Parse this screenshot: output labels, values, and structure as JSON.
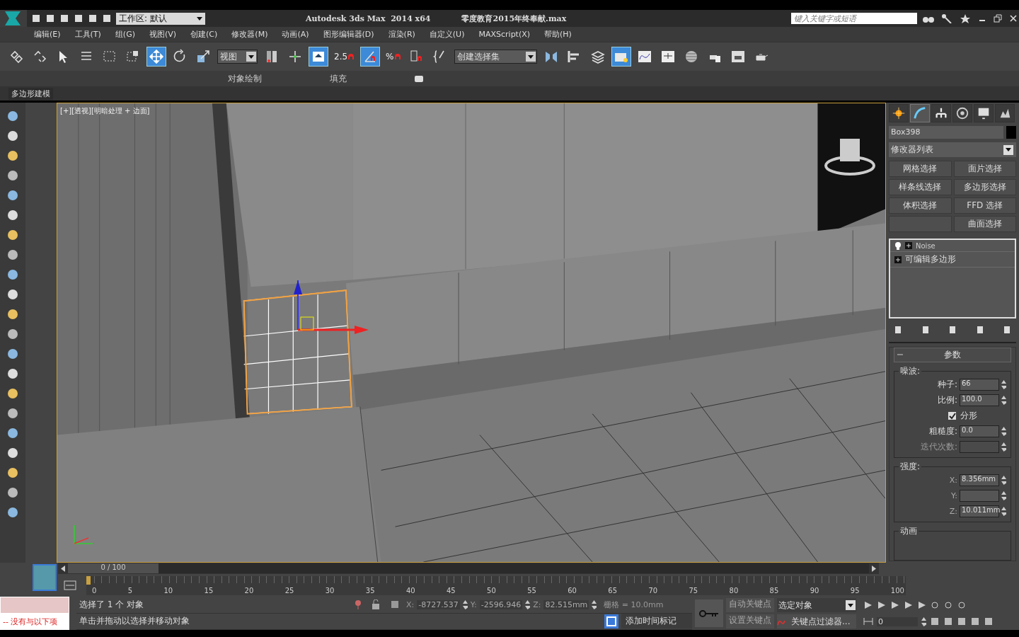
{
  "title_bar": {
    "workspace": "工作区: 默认",
    "app": "Autodesk 3ds Max  2014 x64",
    "file": "零度教育2015年终奉献.max",
    "search": {
      "placeholder": "键入关键字或短语"
    }
  },
  "menu": [
    "编辑(E)",
    "工具(T)",
    "组(G)",
    "视图(V)",
    "创建(C)",
    "修改器(M)",
    "动画(A)",
    "图形编辑器(D)",
    "渲染(R)",
    "自定义(U)",
    "MAXScript(X)",
    "帮助(H)"
  ],
  "main_toolbar": [
    {
      "kind": "icon",
      "active": false
    },
    {
      "kind": "icon",
      "active": false
    },
    {
      "kind": "icon",
      "active": false
    },
    {
      "kind": "icon",
      "active": false
    },
    {
      "kind": "icon",
      "active": false
    },
    {
      "kind": "icon",
      "active": false
    },
    {
      "kind": "icon",
      "active": true
    },
    {
      "kind": "icon",
      "active": false
    },
    {
      "kind": "icon",
      "active": false
    },
    {
      "kind": "dropdown",
      "value": "视图"
    },
    {
      "kind": "icon",
      "active": false
    },
    {
      "kind": "icon",
      "active": false
    },
    {
      "kind": "icon",
      "active": true
    },
    {
      "kind": "snap",
      "label": "2.5",
      "active": false
    },
    {
      "kind": "icon",
      "active": true
    },
    {
      "kind": "snap",
      "label": "%",
      "active": false
    },
    {
      "kind": "icon",
      "active": false
    },
    {
      "kind": "icon",
      "active": false
    },
    {
      "kind": "dropdown",
      "value": "创建选择集"
    },
    {
      "kind": "icon",
      "active": false
    },
    {
      "kind": "icon",
      "active": false
    },
    {
      "kind": "icon",
      "active": false
    },
    {
      "kind": "icon",
      "active": true
    },
    {
      "kind": "icon",
      "active": false
    },
    {
      "kind": "icon",
      "active": false
    },
    {
      "kind": "icon",
      "active": false
    },
    {
      "kind": "icon",
      "active": false
    },
    {
      "kind": "icon",
      "active": false
    },
    {
      "kind": "icon",
      "active": false
    }
  ],
  "ribbon": {
    "tabs": [
      "对象绘制",
      "填充"
    ],
    "panel_label": "多边形建模"
  },
  "viewport": {
    "label": "[+][透视][明暗处理 + 边面]"
  },
  "command_panel": {
    "tabs": [
      {
        "selected": false
      },
      {
        "selected": true
      },
      {
        "selected": false
      },
      {
        "selected": false
      },
      {
        "selected": false
      },
      {
        "selected": false
      }
    ],
    "object_name": "Box398",
    "modifier_list": "修改器列表",
    "modifier_buttons": [
      "网格选择",
      "面片选择",
      "样条线选择",
      "多边形选择",
      "体积选择",
      "FFD 选择",
      "曲面选择"
    ],
    "stack": [
      {
        "label": "Noise",
        "kind": "modifier",
        "expanded": false
      },
      {
        "label": "可编辑多边形",
        "kind": "base",
        "expanded": false
      }
    ],
    "rollout": {
      "title": "参数",
      "noise_group": {
        "title": "噪波:",
        "seed": {
          "label": "种子:",
          "value": "66"
        },
        "scale": {
          "label": "比例:",
          "value": "100.0"
        },
        "fractal": {
          "label": "分形",
          "checked": true
        },
        "roughness": {
          "label": "粗糙度:",
          "value": "0.0"
        },
        "iterations": {
          "label": "迭代次数:",
          "disabled": true
        }
      },
      "strength_group": {
        "title": "强度:",
        "fields": [
          {
            "label": "X:",
            "value": "8.356mm"
          },
          {
            "label": "Y:"
          },
          {
            "label": "Z:",
            "value": "10.011mm"
          }
        ]
      },
      "animation_group": {
        "title": "动画"
      }
    }
  },
  "timeline": {
    "slider": "0 / 100",
    "level": 0,
    "ticks": [
      "0",
      "5",
      "10",
      "15",
      "20",
      "25",
      "30",
      "35",
      "40",
      "45",
      "50",
      "55",
      "60",
      "65",
      "70",
      "75",
      "80",
      "85",
      "90",
      "95",
      "100"
    ]
  },
  "status_bar": {
    "listener": "-- 没有与以下项",
    "selection": "选择了 1 个 对象",
    "prompt": "单击并拖动以选择并移动对象",
    "coords": [
      {
        "label": "X:",
        "value": "-8727.537"
      },
      {
        "label": "Y:",
        "value": "-2596.946"
      },
      {
        "label": "Z:",
        "value": "82.515mm"
      }
    ],
    "grid": "栅格 = 10.0mm",
    "add_time_tag": "添加时间标记",
    "auto_key": "自动关键点",
    "set_key": "设置关键点",
    "key_mode": "选定对象",
    "key_filters": "关键点过滤器...",
    "frame": "0"
  }
}
